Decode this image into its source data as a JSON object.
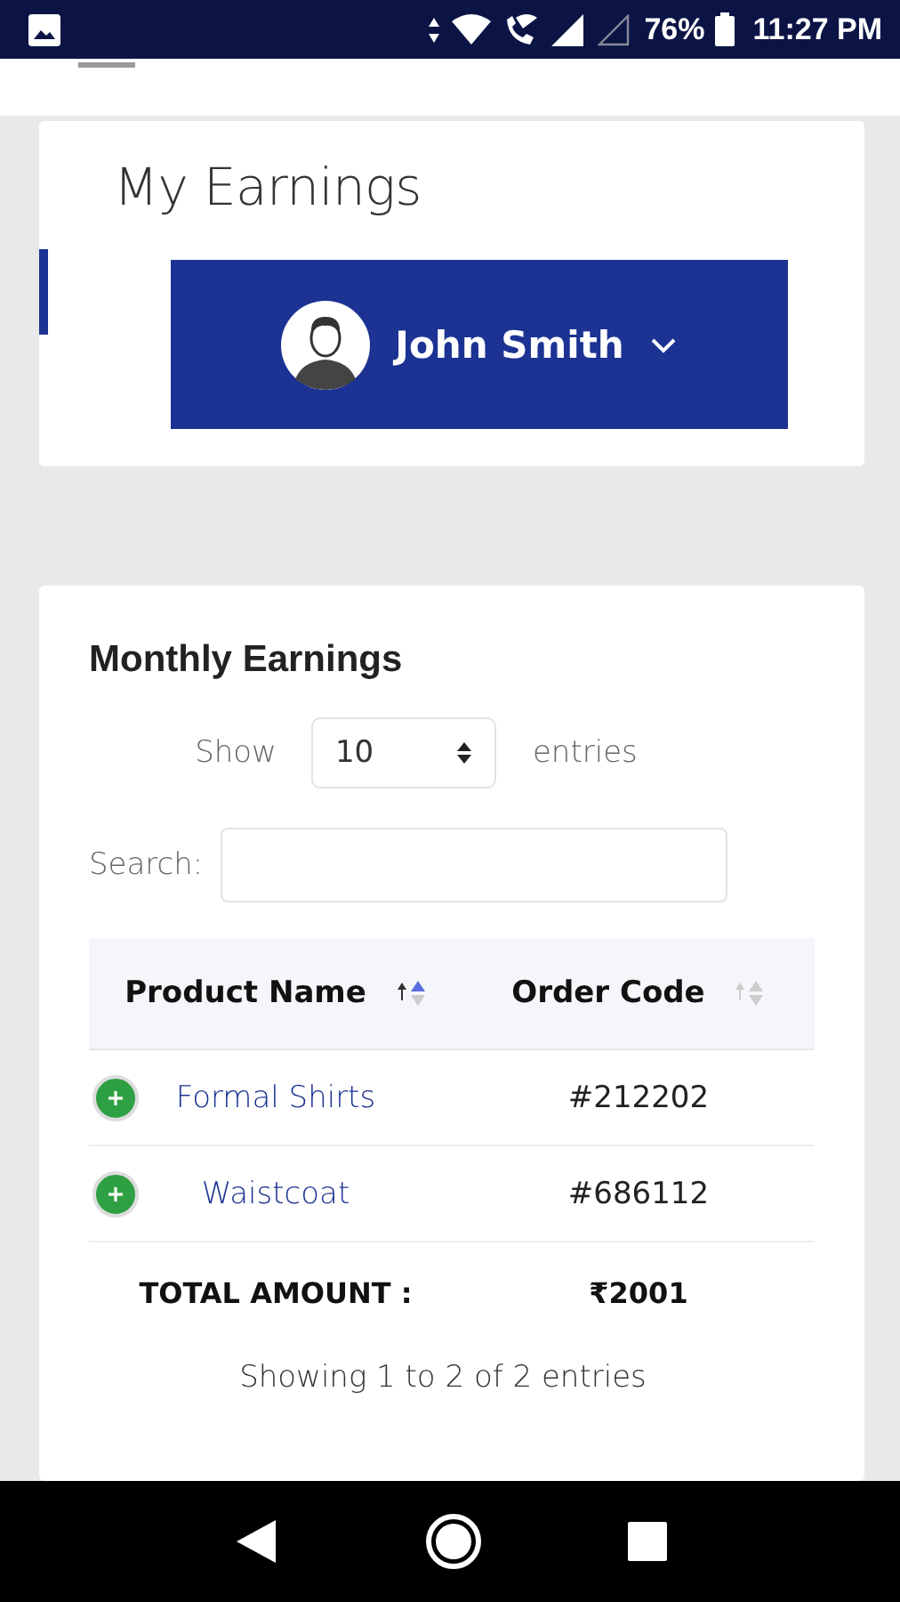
{
  "status_bar": {
    "battery": "76%",
    "time": "11:27 PM"
  },
  "earnings_card": {
    "title": "My Earnings",
    "user_button": {
      "name": "John Smith"
    }
  },
  "monthly_card": {
    "title": "Monthly Earnings",
    "length_control": {
      "prefix": "Show",
      "value": "10",
      "suffix": "entries"
    },
    "search": {
      "label": "Search:"
    },
    "table": {
      "columns": [
        {
          "label": "Product Name",
          "sorted": true
        },
        {
          "label": "Order Code",
          "sorted": false
        }
      ],
      "rows": [
        {
          "product": "Formal Shirts",
          "code": "#212202",
          "expanded": false
        },
        {
          "product": "Waistcoat",
          "code": "#686112",
          "expanded": false
        }
      ],
      "total": {
        "label": "TOTAL AMOUNT :",
        "value": "₹2001"
      }
    },
    "info": "Showing 1 to 2 of 2 entries"
  }
}
